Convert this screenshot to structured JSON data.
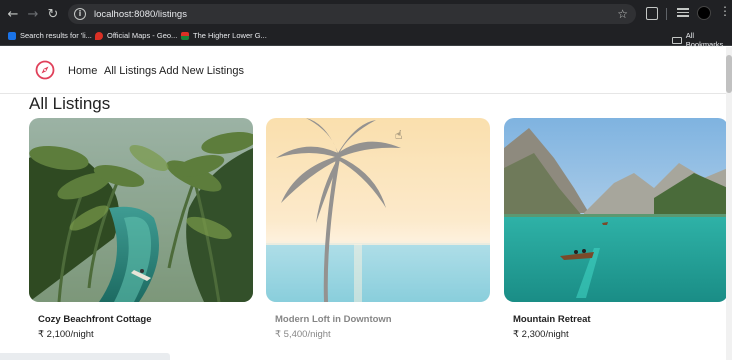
{
  "browser": {
    "url": "localhost:8080/listings",
    "bookmarks": [
      {
        "label": "Search results for 'li...",
        "color": "#1a73e8"
      },
      {
        "label": "Official Maps - Geo...",
        "color": "#d93025"
      },
      {
        "label": "The Higher Lower G...",
        "color": "#188038"
      }
    ],
    "all_bookmarks_label": "All Bookmarks"
  },
  "nav": {
    "home": "Home",
    "all_listings": "All Listings",
    "add_new": "Add New Listings",
    "brand_color": "#e0405a"
  },
  "page": {
    "title": "All Listings"
  },
  "listings": [
    {
      "title": "Cozy Beachfront Cottage",
      "price": "₹ 2,100/night"
    },
    {
      "title": "Modern Loft in Downtown",
      "price": "₹ 5,400/night"
    },
    {
      "title": "Mountain Retreat",
      "price": "₹ 2,300/night"
    }
  ]
}
